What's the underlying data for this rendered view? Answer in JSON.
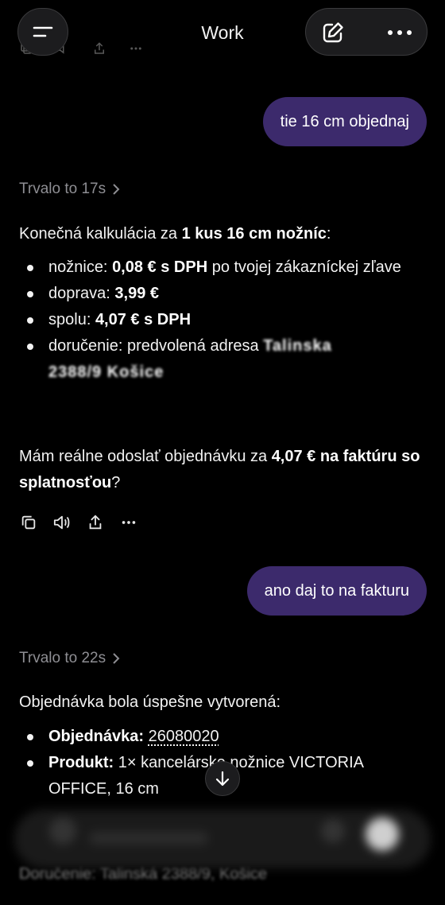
{
  "header": {
    "title": "Work",
    "menu_icon": "menu-icon",
    "edit_icon": "compose-icon",
    "more_icon": "more-icon"
  },
  "messages": {
    "user1": "tie 16 cm objednaj",
    "thought1": "Trvalo to 17s",
    "calc_intro_pre": "Konečná kalkulácia za ",
    "calc_intro_bold": "1 kus 16 cm nožníc",
    "calc_intro_post": ":",
    "items": [
      {
        "label": "nožnice: ",
        "bold": "0,08 € s DPH",
        "rest": " po tvojej zákazníckej zľave"
      },
      {
        "label": "doprava: ",
        "bold": "3,99 €",
        "rest": ""
      },
      {
        "label": "spolu: ",
        "bold": "4,07 € s DPH",
        "rest": ""
      },
      {
        "label": "doručenie: predvolená adresa ",
        "bold": "",
        "rest": ""
      }
    ],
    "redacted_address_1": "Talinska",
    "redacted_address_2": "2388/9 Košice",
    "question_pre": "Mám reálne odoslať objednávku za ",
    "question_bold": "4,07 € na faktúru so splatnosťou",
    "question_post": "?",
    "user2": "ano daj to na fakturu",
    "thought2": "Trvalo to 22s",
    "confirm": "Objednávka bola úspešne vytvorená:",
    "order_label": "Objednávka:",
    "order_number": "26080020",
    "product_label": "Produkt:",
    "product_value": " 1× kancelárske nožnice VICTORIA OFFICE, 16 cm",
    "delivery_faded": "Doručenie: Talinská 2388/9, Košice"
  }
}
